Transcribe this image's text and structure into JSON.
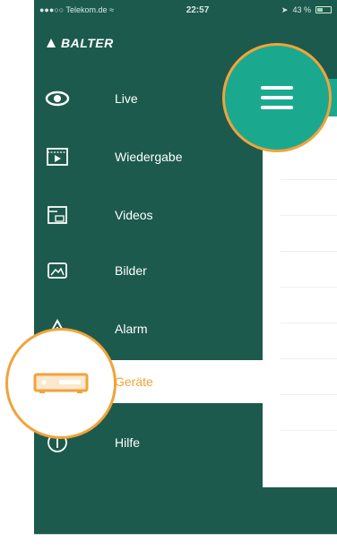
{
  "statusbar": {
    "carrier": "Telekom.de",
    "time": "22:57",
    "battery": "43 %",
    "battery_level": 0.43
  },
  "brand": {
    "name": "BALTER"
  },
  "menu": {
    "items": [
      {
        "label": "Live",
        "icon": "eye-icon"
      },
      {
        "label": "Wiedergabe",
        "icon": "playback-icon"
      },
      {
        "label": "Videos",
        "icon": "video-folder-icon"
      },
      {
        "label": "Bilder",
        "icon": "image-icon"
      },
      {
        "label": "Alarm",
        "icon": "alarm-warning-icon"
      },
      {
        "label": "Geräte",
        "icon": "recorder-device-icon",
        "active": true
      },
      {
        "label": "Hilfe",
        "icon": "info-icon"
      }
    ]
  },
  "colors": {
    "sidebar": "#1c5a4d",
    "accent": "#1aa98f",
    "highlight": "#f2a33a",
    "active_text": "#f2a33a"
  }
}
